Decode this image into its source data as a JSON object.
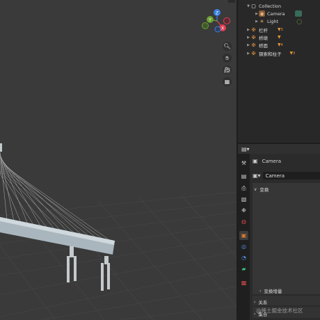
{
  "outliner": {
    "rows": [
      {
        "label": "Collection",
        "icon": "collection-icon",
        "badge": ""
      },
      {
        "label": "Camera",
        "icon": "camera-object-icon",
        "badge": ""
      },
      {
        "label": "Light",
        "icon": "light-object-icon",
        "badge": ""
      },
      {
        "label": "栏杆",
        "icon": "empty-axes-icon",
        "badge": "3"
      },
      {
        "label": "桥墩",
        "icon": "empty-axes-icon",
        "badge": ""
      },
      {
        "label": "桥面",
        "icon": "empty-axes-icon",
        "badge": "4"
      },
      {
        "label": "钢索和柱子",
        "icon": "empty-axes-icon",
        "badge": "3"
      }
    ]
  },
  "viewport": {
    "gizmo": {
      "z": "Z",
      "y": "Y",
      "x": "X"
    }
  },
  "properties": {
    "context_name": "Camera",
    "object_name": "Camera",
    "sections": {
      "transform": "变换",
      "delta_transform": "变换增量",
      "relations": "关系",
      "collections": "集合"
    }
  },
  "watermark": "@稀土掘金技术社区",
  "colors": {
    "accent_orange": "#e7973b",
    "axis_x": "#e63e50",
    "axis_y": "#6ba032",
    "axis_z": "#3b7fe0",
    "active_tab": "#e07a2d"
  }
}
